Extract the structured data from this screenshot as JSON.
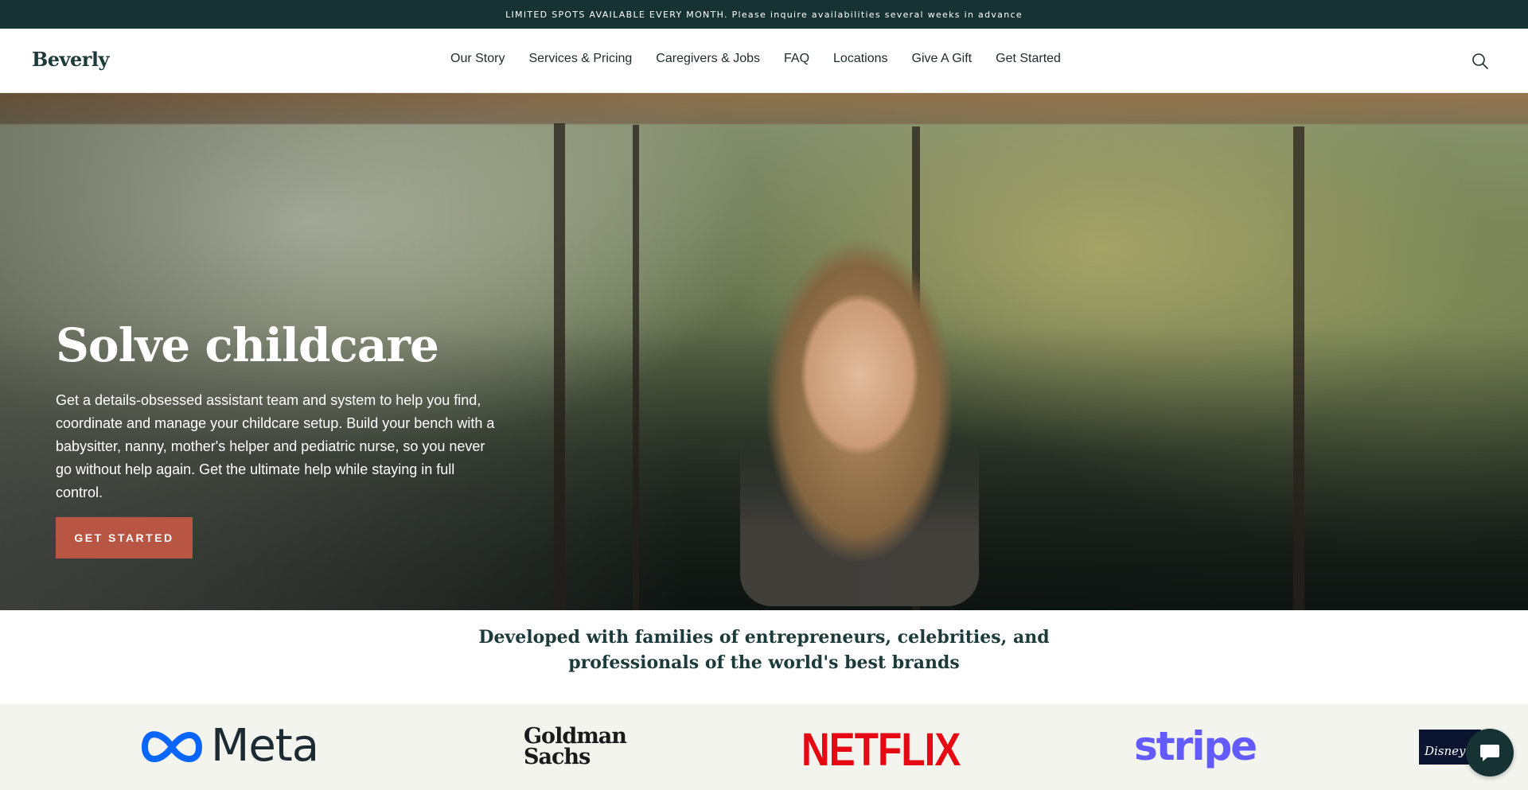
{
  "announcement": "LIMITED SPOTS AVAILABLE EVERY MONTH. Please inquire availabilities several weeks in advance",
  "header": {
    "logo": "Beverly",
    "nav": [
      "Our Story",
      "Services & Pricing",
      "Caregivers & Jobs",
      "FAQ",
      "Locations",
      "Give A Gift",
      "Get Started"
    ],
    "search_icon": "search-icon"
  },
  "hero": {
    "title": "Solve childcare",
    "text": "Get a details-obsessed assistant team and system to help you find, coordinate and manage your childcare setup. Build your bench with a babysitter, nanny, mother's helper and pediatric nurse, so you never go without help again. Get the ultimate help while staying in full control.",
    "cta": "GET STARTED"
  },
  "brands": {
    "heading_line1": "Developed with families of entrepreneurs, celebrities, and",
    "heading_line2": "professionals of the world's best brands",
    "logos": {
      "meta": "Meta",
      "goldman_line1": "Goldman",
      "goldman_line2": "Sachs",
      "netflix": "NETFLIX",
      "stripe": "stripe",
      "disney": "Disney+"
    }
  },
  "chat": {
    "icon": "chat-bubble-icon"
  },
  "colors": {
    "announcement_bg": "#163232",
    "brand_dark": "#1d3a3a",
    "cta": "#b85643",
    "meta_blue": "#0866ff",
    "netflix_red": "#e50914",
    "stripe_purple": "#635bff"
  }
}
